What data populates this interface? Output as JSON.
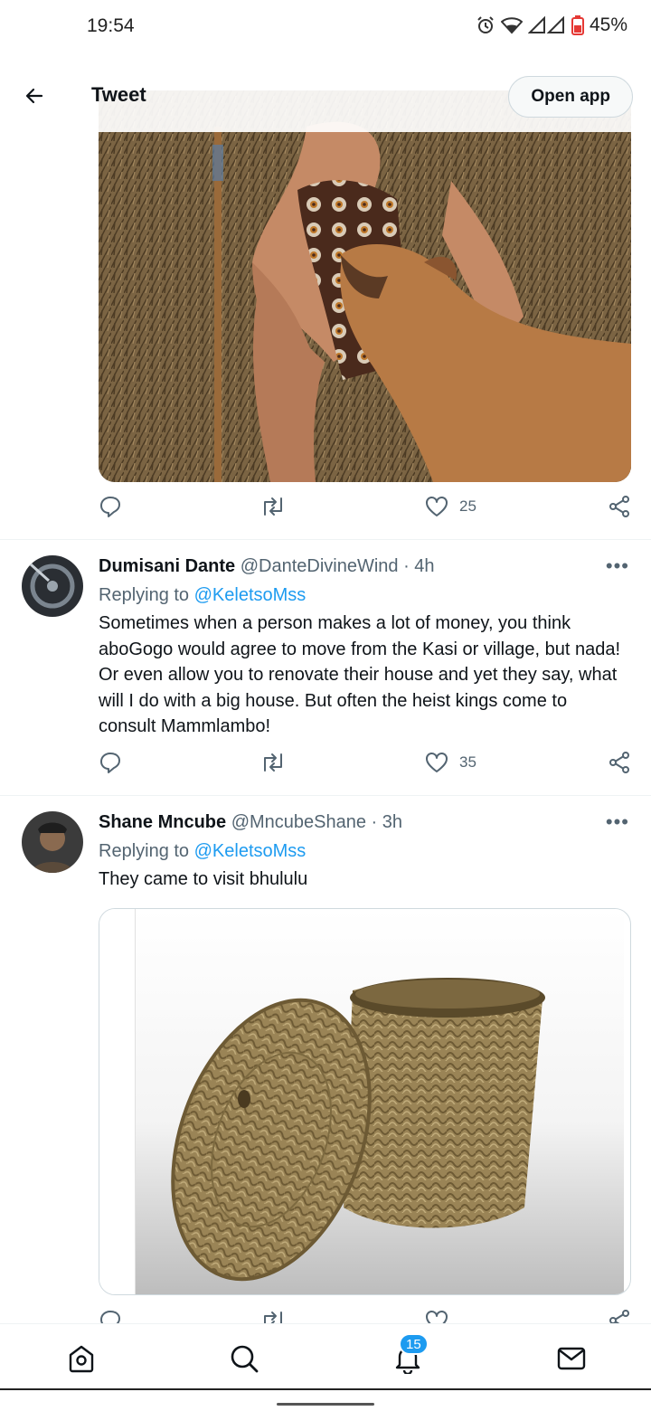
{
  "status_bar": {
    "time": "19:54",
    "battery": "45%"
  },
  "topbar": {
    "title": "Tweet",
    "open_app": "Open app"
  },
  "tweets": [
    {
      "likes": "25"
    },
    {
      "name": "Dumisani Dante",
      "handle": "@DanteDivineWind · 4h",
      "replying_prefix": "Replying to",
      "replying_to": "@KeletsoMss",
      "text": "Sometimes when a person makes a lot of money, you think aboGogo would agree to move from the Kasi or village, but nada! Or even allow you to renovate their house and yet they say, what will I do with a big house. But often the heist kings come to consult Mammlambo!",
      "likes": "35"
    },
    {
      "name": "Shane Mncube",
      "handle": "@MncubeShane · 3h",
      "replying_prefix": "Replying to",
      "replying_to": "@KeletsoMss",
      "text": "They came to visit bhululu"
    }
  ],
  "bottom_nav": {
    "notifications_count": "15"
  },
  "colors": {
    "accent": "#1d9bf0",
    "secondary_text": "#536471",
    "divider": "#eff3f4"
  }
}
